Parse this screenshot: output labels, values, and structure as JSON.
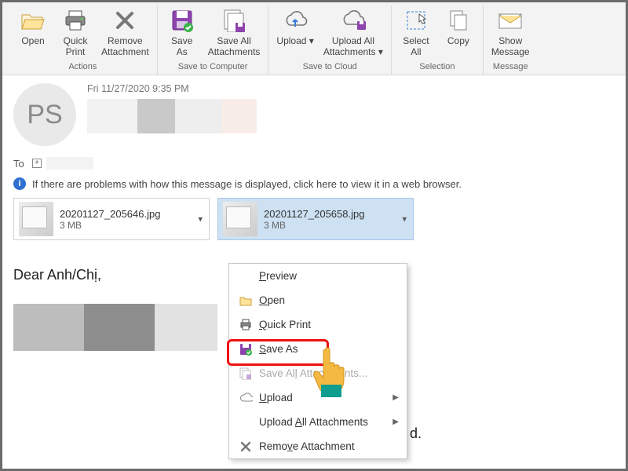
{
  "ribbon": {
    "groups": [
      {
        "label": "Actions",
        "buttons": [
          {
            "key": "open",
            "label": "Open"
          },
          {
            "key": "quickprint",
            "label": "Quick\nPrint"
          },
          {
            "key": "removeattach",
            "label": "Remove\nAttachment"
          }
        ]
      },
      {
        "label": "Save to Computer",
        "buttons": [
          {
            "key": "saveas",
            "label": "Save\nAs"
          },
          {
            "key": "saveall",
            "label": "Save All\nAttachments"
          }
        ]
      },
      {
        "label": "Save to Cloud",
        "buttons": [
          {
            "key": "upload",
            "label": "Upload",
            "dropdown": true
          },
          {
            "key": "uploadall",
            "label": "Upload All\nAttachments",
            "dropdown": true
          }
        ]
      },
      {
        "label": "Selection",
        "buttons": [
          {
            "key": "selectall",
            "label": "Select\nAll"
          },
          {
            "key": "copy",
            "label": "Copy"
          }
        ]
      },
      {
        "label": "Message",
        "buttons": [
          {
            "key": "showmsg",
            "label": "Show\nMessage"
          }
        ]
      }
    ]
  },
  "header": {
    "avatar_initials": "PS",
    "timestamp": "Fri 11/27/2020 9:35 PM",
    "to_label": "To",
    "infobar": "If there are problems with how this message is displayed, click here to view it in a web browser."
  },
  "attachments": [
    {
      "filename": "20201127_205646.jpg",
      "size": "3 MB",
      "selected": false
    },
    {
      "filename": "20201127_205658.jpg",
      "size": "3 MB",
      "selected": true
    }
  ],
  "context_menu": {
    "items": [
      {
        "key": "preview",
        "label_pre": "",
        "accel": "P",
        "label_post": "review",
        "icon": ""
      },
      {
        "key": "open",
        "label_pre": "",
        "accel": "O",
        "label_post": "pen",
        "icon": "folder"
      },
      {
        "key": "qprint",
        "label_pre": "",
        "accel": "Q",
        "label_post": "uick Print",
        "icon": "printer"
      },
      {
        "key": "saveas",
        "label_pre": "",
        "accel": "S",
        "label_post": "ave As",
        "icon": "save",
        "highlight": true
      },
      {
        "key": "saveall",
        "label_pre": "Save Al",
        "accel": "l",
        "label_post": " Attachments...",
        "icon": "saveall",
        "disabled": true
      },
      {
        "key": "upload",
        "label_pre": "",
        "accel": "U",
        "label_post": "pload",
        "icon": "cloud",
        "submenu": true
      },
      {
        "key": "uploadall",
        "label_pre": "Upload ",
        "accel": "A",
        "label_post": "ll Attachments",
        "icon": "",
        "submenu": true
      },
      {
        "key": "remove",
        "label_pre": "Remo",
        "accel": "v",
        "label_post": "e Attachment",
        "icon": "x"
      }
    ]
  },
  "body": {
    "greeting": "Dear Anh/Chị,",
    "trail": "d."
  }
}
